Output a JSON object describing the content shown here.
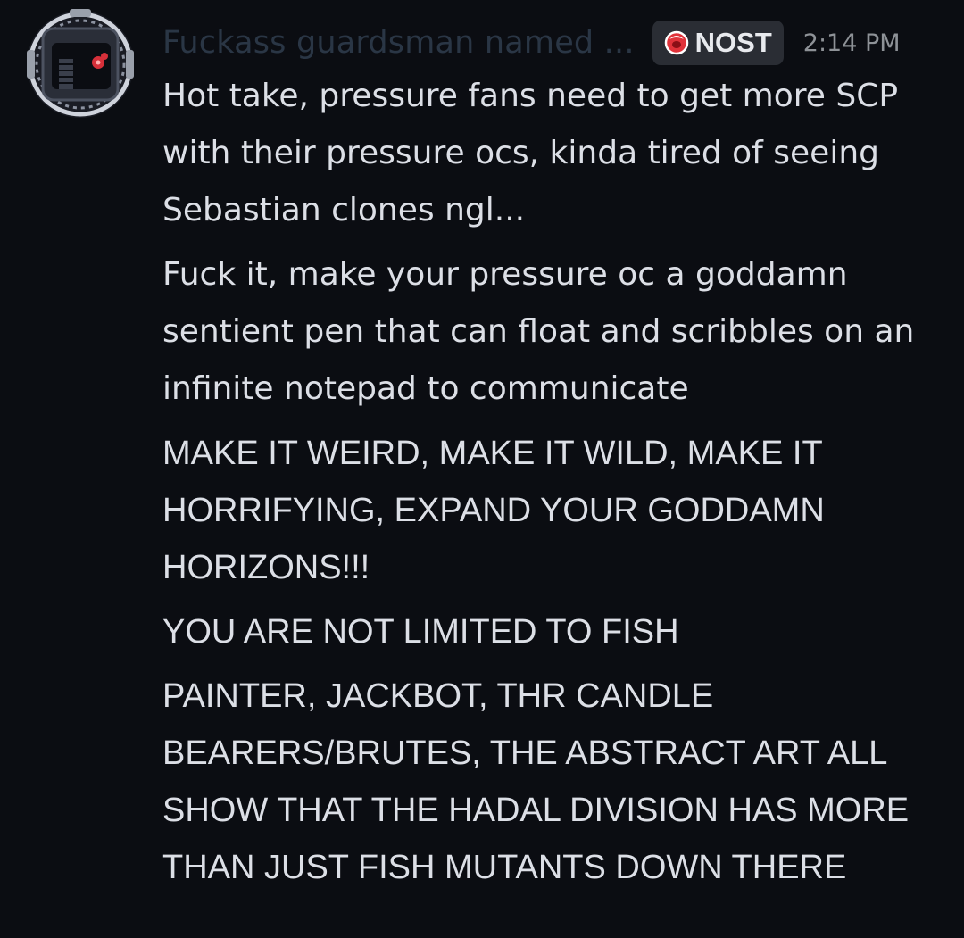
{
  "message": {
    "author": "Fuckass guardsman named ...",
    "tag": "NOST",
    "timestamp": "2:14 PM",
    "paragraphs": [
      "Hot take, pressure fans need to get more SCP with their pressure ocs, kinda tired of seeing Sebastian clones ngl...",
      "Fuck it, make your pressure oc a goddamn sentient pen that can float and scribbles on an infinite notepad to communicate",
      "MAKE IT WEIRD, MAKE IT WILD, MAKE IT HORRIFYING, EXPAND YOUR GODDAMN HORIZONS!!!",
      "YOU ARE NOT LIMITED TO FISH",
      "PAINTER, JACKBOT, THR CANDLE BEARERS/BRUTES, THE ABSTRACT ART ALL SHOW THAT THE HADAL DIVISION HAS MORE THAN JUST FISH MUTANTS DOWN THERE"
    ]
  },
  "icons": {
    "avatar": "diving-helmet-avatar-icon",
    "tag": "red-ring-icon"
  },
  "colors": {
    "background": "#0b0d12",
    "username": "#2a3645",
    "tag_background": "#2a2d34",
    "tag_icon": "#e0323a",
    "timestamp": "#8e9297",
    "body_text": "#dcdfe6"
  }
}
